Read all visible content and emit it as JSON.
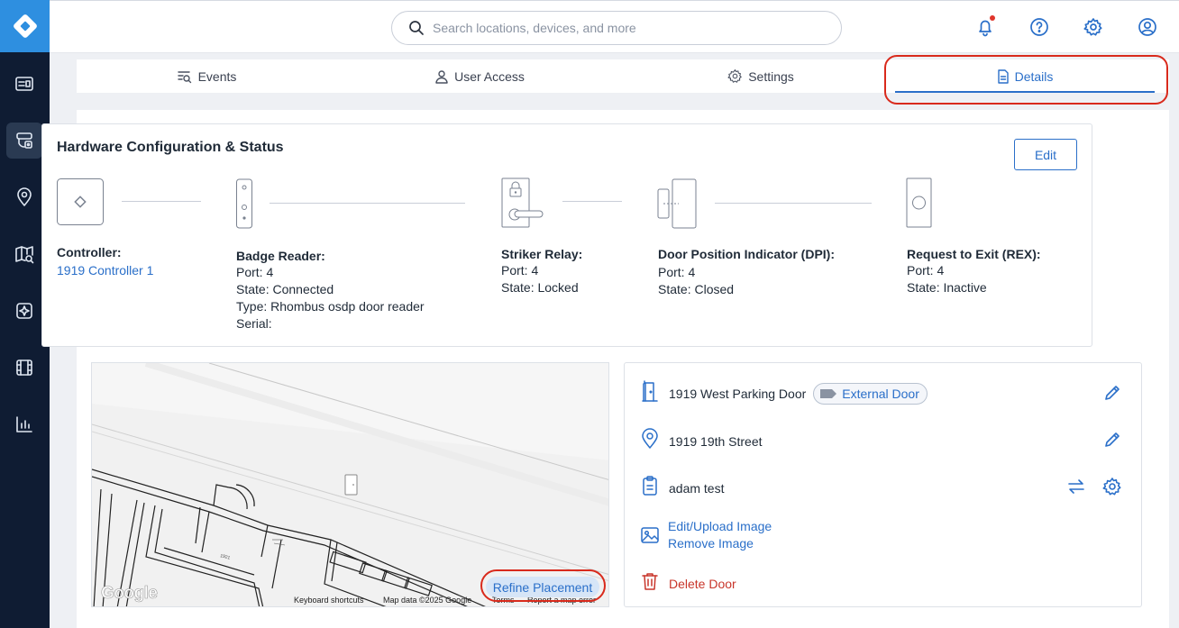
{
  "search": {
    "placeholder": "Search locations, devices, and more"
  },
  "tabs": [
    {
      "label": "Events"
    },
    {
      "label": "User Access"
    },
    {
      "label": "Settings"
    },
    {
      "label": "Details"
    }
  ],
  "hardware": {
    "title": "Hardware Configuration & Status",
    "edit_label": "Edit",
    "controller": {
      "label": "Controller:",
      "value": "1919 Controller 1"
    },
    "badge_reader": {
      "label": "Badge Reader:",
      "port": "Port: 4",
      "state": "State: Connected",
      "type": "Type: Rhombus osdp door reader",
      "serial": "Serial:"
    },
    "striker_relay": {
      "label": "Striker Relay:",
      "port": "Port: 4",
      "state": "State: Locked"
    },
    "dpi": {
      "label": "Door Position Indicator (DPI):",
      "port": "Port: 4",
      "state": "State: Closed"
    },
    "rex": {
      "label": "Request to Exit (REX):",
      "port": "Port: 4",
      "state": "State: Inactive"
    }
  },
  "map": {
    "google": "Google",
    "shortcuts": "Keyboard shortcuts",
    "map_data": "Map data ©2025 Google",
    "terms": "Terms",
    "report": "Report a map error",
    "refine_label": "Refine Placement"
  },
  "details": {
    "door_name": "1919 West Parking Door",
    "door_type": "External Door",
    "address": "1919 19th Street",
    "policy": "adam test",
    "edit_image": "Edit/Upload Image",
    "remove_image": "Remove Image",
    "delete_label": "Delete Door"
  },
  "colors": {
    "accent": "#2a6fc9",
    "highlight": "#d92a1c",
    "sidebar": "#0f1c33",
    "logo": "#2e8fe0",
    "danger": "#c8352a"
  }
}
